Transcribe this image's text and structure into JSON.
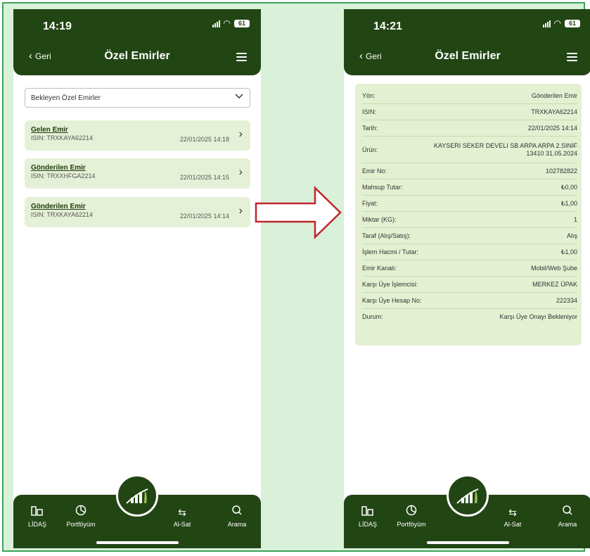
{
  "left_screen": {
    "time": "14:19",
    "battery": "61",
    "back_label": "Geri",
    "title": "Özel Emirler",
    "select_value": "Bekleyen Özel Emirler",
    "orders": [
      {
        "title": "Gelen Emir",
        "isin": "ISIN: TRXKAYA62214",
        "date": "22/01/2025 14:18"
      },
      {
        "title": "Gönderilen Emir",
        "isin": "ISIN: TRXXHFGA2214",
        "date": "22/01/2025 14:15"
      },
      {
        "title": "Gönderilen Emir",
        "isin": "ISIN: TRXKAYA62214",
        "date": "22/01/2025 14:14"
      }
    ]
  },
  "right_screen": {
    "time": "14:21",
    "battery": "61",
    "back_label": "Geri",
    "title": "Özel Emirler",
    "details": [
      {
        "label": "Yön:",
        "value": "Gönderilen Emir"
      },
      {
        "label": "ISIN:",
        "value": "TRXKAYA62214"
      },
      {
        "label": "Tarih:",
        "value": "22/01/2025 14:14"
      },
      {
        "label": "Ürün:",
        "value": "KAYSERI SEKER DEVELI SB ARPA ARPA 2.SINIF 13410 31.05.2024"
      },
      {
        "label": "Emir No:",
        "value": "102782822"
      },
      {
        "label": "Mahsup Tutar:",
        "value": "₺0,00"
      },
      {
        "label": "Fiyat:",
        "value": "₺1,00"
      },
      {
        "label": "Miktar (KG):",
        "value": "1"
      },
      {
        "label": "Taraf (Alış/Satış):",
        "value": "Alış"
      },
      {
        "label": "İşlem Hacmi / Tutar:",
        "value": "₺1,00"
      },
      {
        "label": "Emir Kanalı:",
        "value": "Mobil/Web Şube"
      },
      {
        "label": "Karşı Üye İşlemcisi:",
        "value": "MERKEZ ÜPAK"
      },
      {
        "label": "Karşı Üye Hesap No:",
        "value": "222334"
      },
      {
        "label": "Durum:",
        "value": "Karşı Üye Onayı Bekleniyor"
      }
    ]
  },
  "tabbar": {
    "items": [
      {
        "label": "LİDAŞ",
        "icon": "building-icon"
      },
      {
        "label": "Portföyüm",
        "icon": "pie-chart-icon"
      },
      {
        "label": "Al-Sat",
        "icon": "swap-arrows-icon"
      },
      {
        "label": "Arama",
        "icon": "search-icon"
      }
    ]
  },
  "colors": {
    "header_bg": "#224514",
    "card_bg": "#e3f0d2",
    "frame_border": "#3aa55a",
    "frame_bg": "#d9f1d9",
    "arrow": "#c0262d"
  }
}
